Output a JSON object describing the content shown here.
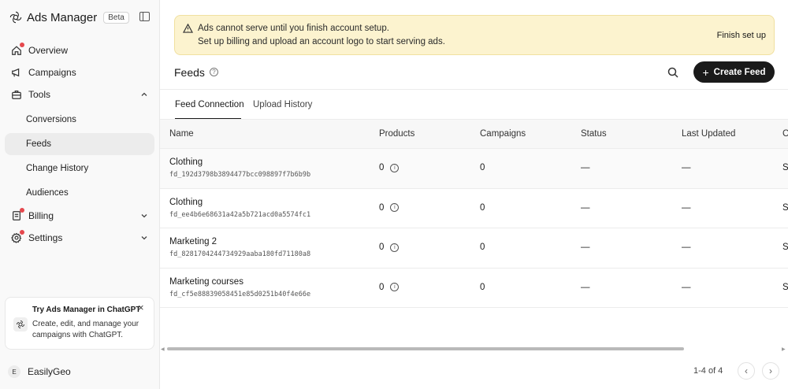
{
  "app": {
    "title": "Ads Manager",
    "badge": "Beta"
  },
  "sidebar": {
    "items": [
      {
        "label": "Overview"
      },
      {
        "label": "Campaigns"
      },
      {
        "label": "Tools"
      },
      {
        "label": "Conversions"
      },
      {
        "label": "Feeds"
      },
      {
        "label": "Change History"
      },
      {
        "label": "Audiences"
      },
      {
        "label": "Billing"
      },
      {
        "label": "Settings"
      }
    ]
  },
  "promo": {
    "title": "Try Ads Manager in ChatGPT",
    "body": "Create, edit, and manage your campaigns with ChatGPT.",
    "close": "×"
  },
  "account": {
    "initial": "E",
    "name": "EasilyGeo"
  },
  "alert": {
    "title": "Ads cannot serve until you finish account setup.",
    "text": "Set up billing and upload an account logo to start serving ads.",
    "action": "Finish set up"
  },
  "page": {
    "title": "Feeds",
    "create_label": "Create Feed"
  },
  "tabs": [
    {
      "label": "Feed Connection"
    },
    {
      "label": "Upload History"
    }
  ],
  "table": {
    "headers": [
      "Name",
      "Products",
      "Campaigns",
      "Status",
      "Last Updated",
      "C"
    ],
    "rows": [
      {
        "name": "Clothing",
        "id": "fd_192d3798b3894477bcc098897f7b6b9b",
        "products": "0",
        "campaigns": "0",
        "status": "—",
        "updated": "—",
        "clipped": "S"
      },
      {
        "name": "Clothing",
        "id": "fd_ee4b6e68631a42a5b721acd0a5574fc1",
        "products": "0",
        "campaigns": "0",
        "status": "—",
        "updated": "—",
        "clipped": "S"
      },
      {
        "name": "Marketing 2",
        "id": "fd_8281704244734929aaba180fd71180a8",
        "products": "0",
        "campaigns": "0",
        "status": "—",
        "updated": "—",
        "clipped": "S"
      },
      {
        "name": "Marketing courses",
        "id": "fd_cf5e88839058451e85d0251b40f4e66e",
        "products": "0",
        "campaigns": "0",
        "status": "—",
        "updated": "—",
        "clipped": "S"
      }
    ]
  },
  "pagination": {
    "label": "1-4 of 4",
    "prev": "‹",
    "next": "›"
  },
  "icons": {
    "logo": "openai-logo-icon",
    "overview": "home-icon",
    "campaigns": "megaphone-icon",
    "tools": "toolbox-icon",
    "billing": "receipt-icon",
    "settings": "gear-icon",
    "alert": "warning-icon",
    "search": "search-icon"
  },
  "colors": {
    "alert_bg": "#fcf3cf",
    "primary_button": "#1a1a1a",
    "notification_dot": "#e5484d",
    "active_nav": "#ececec"
  }
}
